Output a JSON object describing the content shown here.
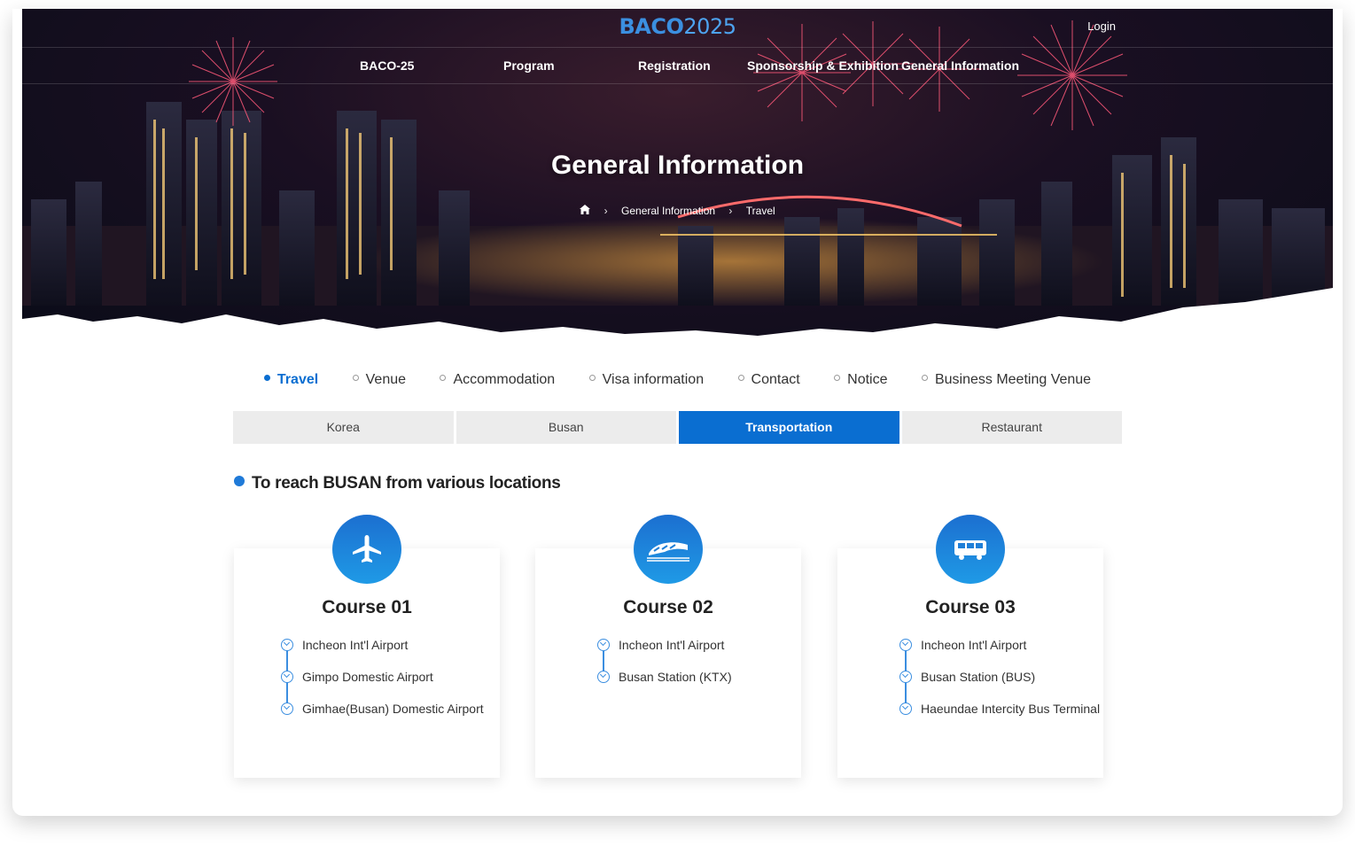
{
  "header": {
    "logo_main": "BACO",
    "logo_year": "2025",
    "login": "Login",
    "nav": [
      "BACO-25",
      "Program",
      "Registration",
      "Sponsorship & Exhibition",
      "General Information"
    ]
  },
  "hero": {
    "title": "General Information",
    "breadcrumb": [
      "General Information",
      "Travel"
    ]
  },
  "tabs": [
    {
      "label": "Travel",
      "active": true
    },
    {
      "label": "Venue",
      "active": false
    },
    {
      "label": "Accommodation",
      "active": false
    },
    {
      "label": "Visa information",
      "active": false
    },
    {
      "label": "Contact",
      "active": false
    },
    {
      "label": "Notice",
      "active": false
    },
    {
      "label": "Business Meeting Venue",
      "active": false
    }
  ],
  "subtabs": [
    {
      "label": "Korea",
      "active": false
    },
    {
      "label": "Busan",
      "active": false
    },
    {
      "label": "Transportation",
      "active": true
    },
    {
      "label": "Restaurant",
      "active": false
    }
  ],
  "section": {
    "title": "To reach BUSAN from various locations"
  },
  "courses": [
    {
      "title": "Course 01",
      "icon": "airplane-icon",
      "steps": [
        "Incheon Int'l Airport",
        "Gimpo Domestic Airport",
        "Gimhae(Busan) Domestic Airport"
      ]
    },
    {
      "title": "Course 02",
      "icon": "train-icon",
      "steps": [
        "Incheon Int'l Airport",
        "Busan Station (KTX)"
      ]
    },
    {
      "title": "Course 03",
      "icon": "bus-icon",
      "steps": [
        "Incheon Int'l Airport",
        "Busan Station (BUS)",
        "Haeundae Intercity Bus Terminal"
      ]
    }
  ],
  "colors": {
    "accent": "#0a6ed1",
    "icon_gradient_top": "#1c6fd0",
    "icon_gradient_bottom": "#1f9ae6"
  }
}
